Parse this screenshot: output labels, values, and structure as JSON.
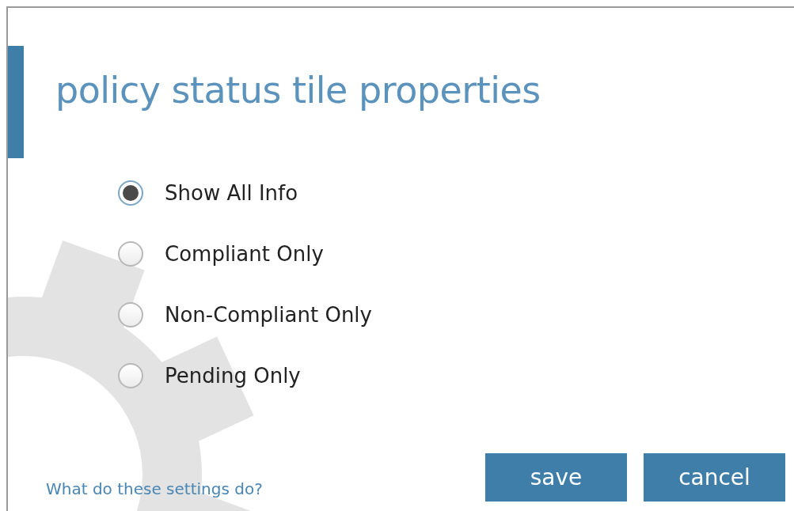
{
  "dialog": {
    "title": "policy status tile properties"
  },
  "options": [
    {
      "label": "Show All Info",
      "selected": true
    },
    {
      "label": "Compliant Only",
      "selected": false
    },
    {
      "label": "Non-Compliant Only",
      "selected": false
    },
    {
      "label": "Pending Only",
      "selected": false
    }
  ],
  "help_link": "What do these settings do?",
  "buttons": [
    {
      "label": "save"
    },
    {
      "label": "cancel"
    }
  ]
}
